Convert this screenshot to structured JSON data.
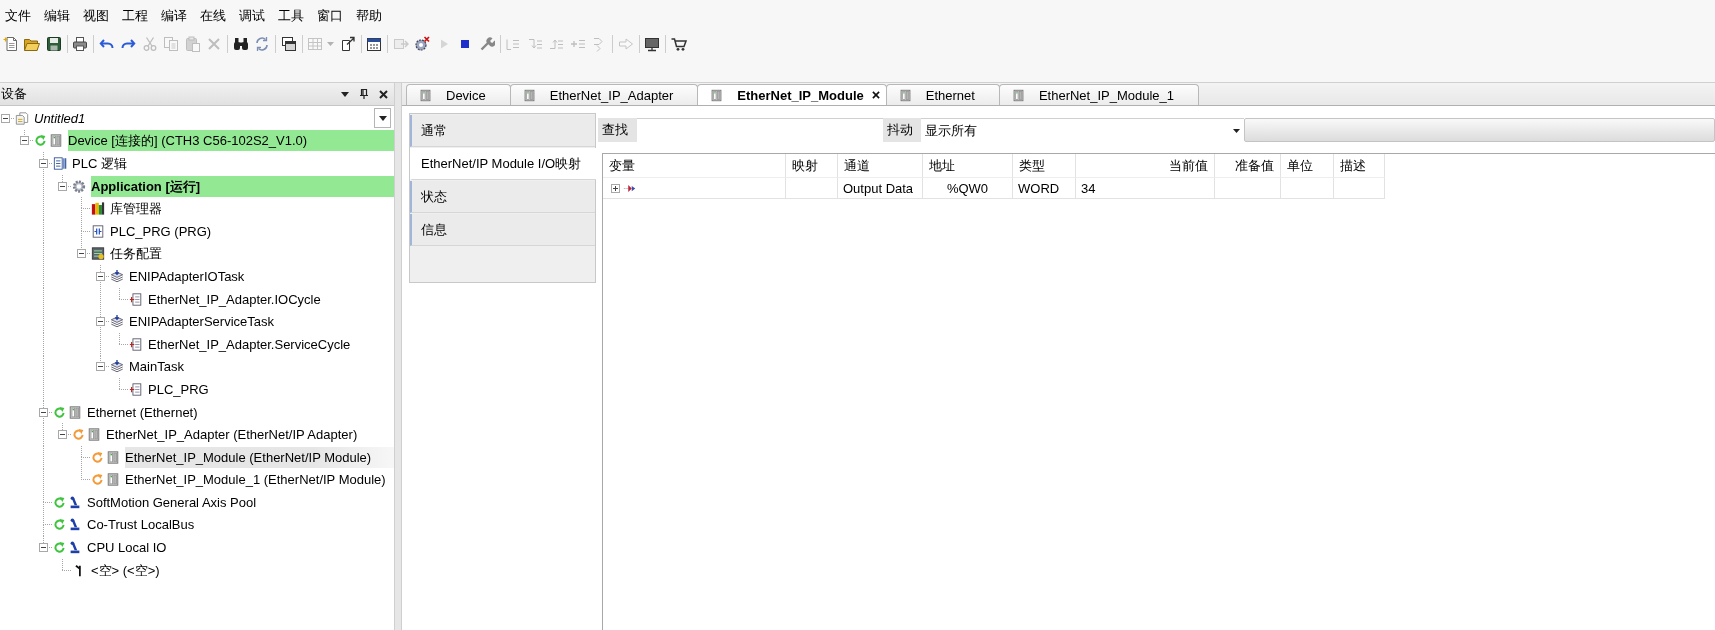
{
  "menu": [
    "文件",
    "编辑",
    "视图",
    "工程",
    "编译",
    "在线",
    "调试",
    "工具",
    "窗口",
    "帮助"
  ],
  "toolbar": {
    "groups": [
      {
        "buttons": [
          {
            "disabled": false
          },
          {
            "disabled": false
          },
          {
            "disabled": false
          }
        ]
      },
      {
        "buttons": [
          {
            "disabled": false
          }
        ]
      },
      {
        "buttons": [
          {
            "disabled": false
          },
          {
            "disabled": false
          },
          {
            "disabled": true
          },
          {
            "disabled": true
          },
          {
            "disabled": true
          },
          {
            "disabled": true
          }
        ]
      },
      {
        "buttons": [
          {
            "disabled": false
          },
          {
            "disabled": false
          }
        ]
      },
      {
        "buttons": [
          {
            "disabled": false
          }
        ]
      },
      {
        "buttons": [
          {
            "disabled": true
          },
          {
            "disabled": false
          }
        ]
      },
      {
        "buttons": [
          {
            "disabled": false
          }
        ]
      },
      {
        "buttons": [
          {
            "disabled": true
          },
          {
            "disabled": false
          },
          {
            "disabled": true
          },
          {
            "disabled": false
          },
          {
            "disabled": false
          }
        ]
      },
      {
        "buttons": [
          {
            "disabled": true
          },
          {
            "disabled": true
          },
          {
            "disabled": true
          },
          {
            "disabled": true
          },
          {
            "disabled": true
          }
        ]
      },
      {
        "buttons": [
          {
            "disabled": true
          }
        ]
      },
      {
        "buttons": [
          {
            "disabled": false
          }
        ]
      },
      {
        "buttons": [
          {
            "disabled": false
          }
        ]
      }
    ]
  },
  "devices_panel": {
    "title": "设备",
    "tree": [
      {
        "label": "Untitled1",
        "kind": "project",
        "expanded": true,
        "selected": false,
        "highlighted": false,
        "active": false,
        "children": [
          {
            "label": "Device [连接的] (CTH3 C56-102S2_V1.0)",
            "kind": "device",
            "color": "#3fc43f",
            "expanded": true,
            "selected": false,
            "highlighted": true,
            "active": false,
            "children": [
              {
                "label": "PLC 逻辑",
                "kind": "logic",
                "expanded": true,
                "selected": false,
                "highlighted": false,
                "active": false,
                "children": [
                  {
                    "label": "Application [运行]",
                    "kind": "application",
                    "expanded": true,
                    "selected": false,
                    "highlighted": true,
                    "active": true,
                    "children": [
                      {
                        "label": "库管理器",
                        "kind": "library",
                        "selected": false,
                        "highlighted": false,
                        "active": false
                      },
                      {
                        "label": "PLC_PRG (PRG)",
                        "kind": "program",
                        "selected": false,
                        "highlighted": false,
                        "active": false
                      },
                      {
                        "label": "任务配置",
                        "kind": "taskconfig",
                        "expanded": true,
                        "selected": false,
                        "highlighted": false,
                        "active": false,
                        "children": [
                          {
                            "label": "ENIPAdapterIOTask",
                            "kind": "task",
                            "expanded": true,
                            "selected": false,
                            "highlighted": false,
                            "active": false,
                            "children": [
                              {
                                "label": "EtherNet_IP_Adapter.IOCycle",
                                "kind": "call",
                                "selected": false,
                                "highlighted": false,
                                "active": false
                              }
                            ]
                          },
                          {
                            "label": "ENIPAdapterServiceTask",
                            "kind": "task",
                            "expanded": true,
                            "selected": false,
                            "highlighted": false,
                            "active": false,
                            "children": [
                              {
                                "label": "EtherNet_IP_Adapter.ServiceCycle",
                                "kind": "call",
                                "selected": false,
                                "highlighted": false,
                                "active": false
                              }
                            ]
                          },
                          {
                            "label": "MainTask",
                            "kind": "task",
                            "expanded": true,
                            "selected": false,
                            "highlighted": false,
                            "active": false,
                            "children": [
                              {
                                "label": "PLC_PRG",
                                "kind": "call",
                                "selected": false,
                                "highlighted": false,
                                "active": false
                              }
                            ]
                          }
                        ]
                      }
                    ]
                  }
                ]
              },
              {
                "label": "Ethernet (Ethernet)",
                "kind": "device",
                "color": "#3fc43f",
                "expanded": true,
                "selected": false,
                "highlighted": false,
                "active": false,
                "children": [
                  {
                    "label": "EtherNet_IP_Adapter (EtherNet/IP Adapter)",
                    "kind": "device",
                    "color": "#f39a3a",
                    "expanded": true,
                    "selected": false,
                    "highlighted": false,
                    "active": false,
                    "children": [
                      {
                        "label": "EtherNet_IP_Module (EtherNet/IP Module)",
                        "kind": "device",
                        "color": "#f39a3a",
                        "selected": true,
                        "highlighted": false,
                        "active": false
                      },
                      {
                        "label": "EtherNet_IP_Module_1 (EtherNet/IP Module)",
                        "kind": "device",
                        "color": "#f39a3a",
                        "selected": false,
                        "highlighted": false,
                        "active": false
                      }
                    ]
                  }
                ]
              },
              {
                "label": "SoftMotion General Axis Pool",
                "kind": "axis",
                "color": "#3fc43f",
                "selected": false,
                "highlighted": false,
                "active": false
              },
              {
                "label": "Co-Trust LocalBus",
                "kind": "axis",
                "color": "#3fc43f",
                "selected": false,
                "highlighted": false,
                "active": false
              },
              {
                "label": "CPU Local IO",
                "kind": "axis",
                "color": "#3fc43f",
                "expanded": true,
                "selected": false,
                "highlighted": false,
                "active": false,
                "children": [
                  {
                    "label": "<空> (<空>)",
                    "kind": "slot",
                    "selected": false,
                    "highlighted": false,
                    "active": false
                  }
                ]
              }
            ]
          }
        ]
      }
    ]
  },
  "editor": {
    "tabs": [
      {
        "label": "Device",
        "selected": false
      },
      {
        "label": "EtherNet_IP_Adapter",
        "selected": false
      },
      {
        "label": "EtherNet_IP_Module",
        "selected": true
      },
      {
        "label": "Ethernet",
        "selected": false
      },
      {
        "label": "EtherNet_IP_Module_1",
        "selected": false
      }
    ],
    "side_tabs": [
      {
        "label": "通常",
        "selected": false
      },
      {
        "label": "EtherNet/IP Module I/O映射",
        "selected": true
      },
      {
        "label": "状态",
        "selected": false
      },
      {
        "label": "信息",
        "selected": false
      }
    ],
    "filter": {
      "find_label": "查找",
      "filter_label": "抖动",
      "filter_value": "显示所有"
    },
    "table": {
      "columns": [
        "变量",
        "映射",
        "通道",
        "地址",
        "类型",
        "当前值",
        "准备值",
        "单位",
        "描述"
      ],
      "rows": [
        {
          "expanded": false,
          "channel": "Output Data",
          "address": "%QW0",
          "type": "WORD",
          "current_value": "34"
        }
      ]
    }
  }
}
